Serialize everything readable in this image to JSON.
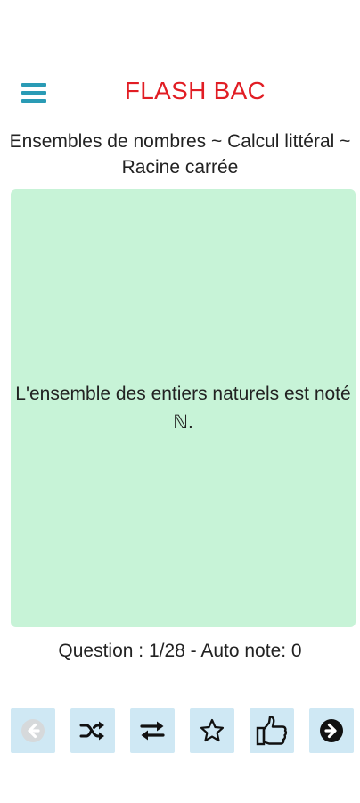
{
  "header": {
    "title": "FLASH BAC"
  },
  "subtitle": "Ensembles de nombres ~ Calcul littéral ~ Racine carrée",
  "card": {
    "text": "L'ensemble des entiers naturels est noté ℕ."
  },
  "status": "Question : 1/28 - Auto note: 0",
  "toolbar": {
    "buttons": [
      {
        "icon": "arrow-left-circle-icon",
        "enabled": false
      },
      {
        "icon": "shuffle-icon",
        "enabled": true
      },
      {
        "icon": "repeat-icon",
        "enabled": true
      },
      {
        "icon": "star-icon",
        "enabled": true
      },
      {
        "icon": "thumbs-up-icon",
        "enabled": true
      },
      {
        "icon": "arrow-right-circle-icon",
        "enabled": true
      }
    ]
  },
  "colors": {
    "accent": "#2a9bb5",
    "title": "#e11d24",
    "card_background": "#c7f3d7",
    "button_background": "#cfe8f4"
  }
}
